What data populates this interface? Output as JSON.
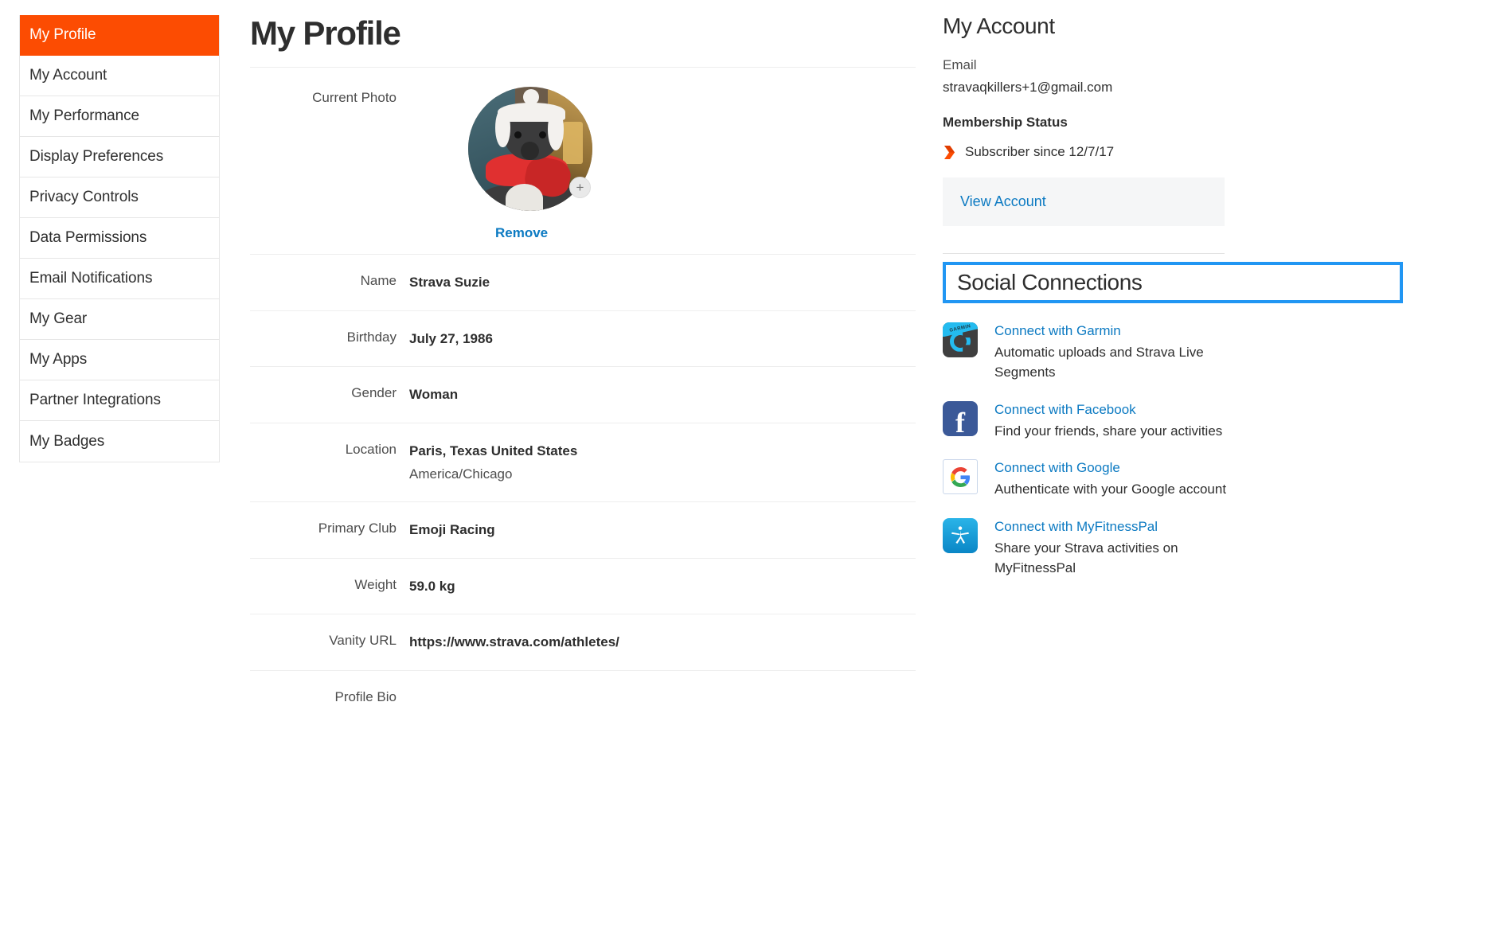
{
  "sidebar": {
    "items": [
      {
        "label": "My Profile",
        "active": true
      },
      {
        "label": "My Account",
        "active": false
      },
      {
        "label": "My Performance",
        "active": false
      },
      {
        "label": "Display Preferences",
        "active": false
      },
      {
        "label": "Privacy Controls",
        "active": false
      },
      {
        "label": "Data Permissions",
        "active": false
      },
      {
        "label": "Email Notifications",
        "active": false
      },
      {
        "label": "My Gear",
        "active": false
      },
      {
        "label": "My Apps",
        "active": false
      },
      {
        "label": "Partner Integrations",
        "active": false
      },
      {
        "label": "My Badges",
        "active": false
      }
    ]
  },
  "main": {
    "title": "My Profile",
    "photo": {
      "label": "Current Photo",
      "remove_label": "Remove",
      "add_icon": "+"
    },
    "fields": [
      {
        "label": "Name",
        "value": "Strava Suzie",
        "sub": ""
      },
      {
        "label": "Birthday",
        "value": "July 27, 1986",
        "sub": ""
      },
      {
        "label": "Gender",
        "value": "Woman",
        "sub": ""
      },
      {
        "label": "Location",
        "value": "Paris, Texas United States",
        "sub": "America/Chicago"
      },
      {
        "label": "Primary Club",
        "value": "Emoji Racing",
        "sub": ""
      },
      {
        "label": "Weight",
        "value": "59.0 kg",
        "sub": ""
      },
      {
        "label": "Vanity URL",
        "value": "https://www.strava.com/athletes/",
        "sub": ""
      },
      {
        "label": "Profile Bio",
        "value": "",
        "sub": ""
      }
    ]
  },
  "rail": {
    "account_title": "My Account",
    "email_label": "Email",
    "email_value": "stravaqkillers+1@gmail.com",
    "membership_label": "Membership Status",
    "membership_value": "Subscriber since 12/7/17",
    "view_account_label": "View Account",
    "social_title": "Social Connections",
    "social_items": [
      {
        "icon": "garmin-icon",
        "link": "Connect with Garmin",
        "desc": "Automatic uploads and Strava Live Segments"
      },
      {
        "icon": "facebook-icon",
        "link": "Connect with Facebook",
        "desc": "Find your friends, share your activities"
      },
      {
        "icon": "google-icon",
        "link": "Connect with Google",
        "desc": "Authenticate with your Google account"
      },
      {
        "icon": "myfitnesspal-icon",
        "link": "Connect with MyFitnessPal",
        "desc": "Share your Strava activities on MyFitnessPal"
      }
    ]
  },
  "colors": {
    "accent_orange": "#fc4c02",
    "link_blue": "#0c7ac2",
    "highlight_blue": "#2196f3"
  }
}
